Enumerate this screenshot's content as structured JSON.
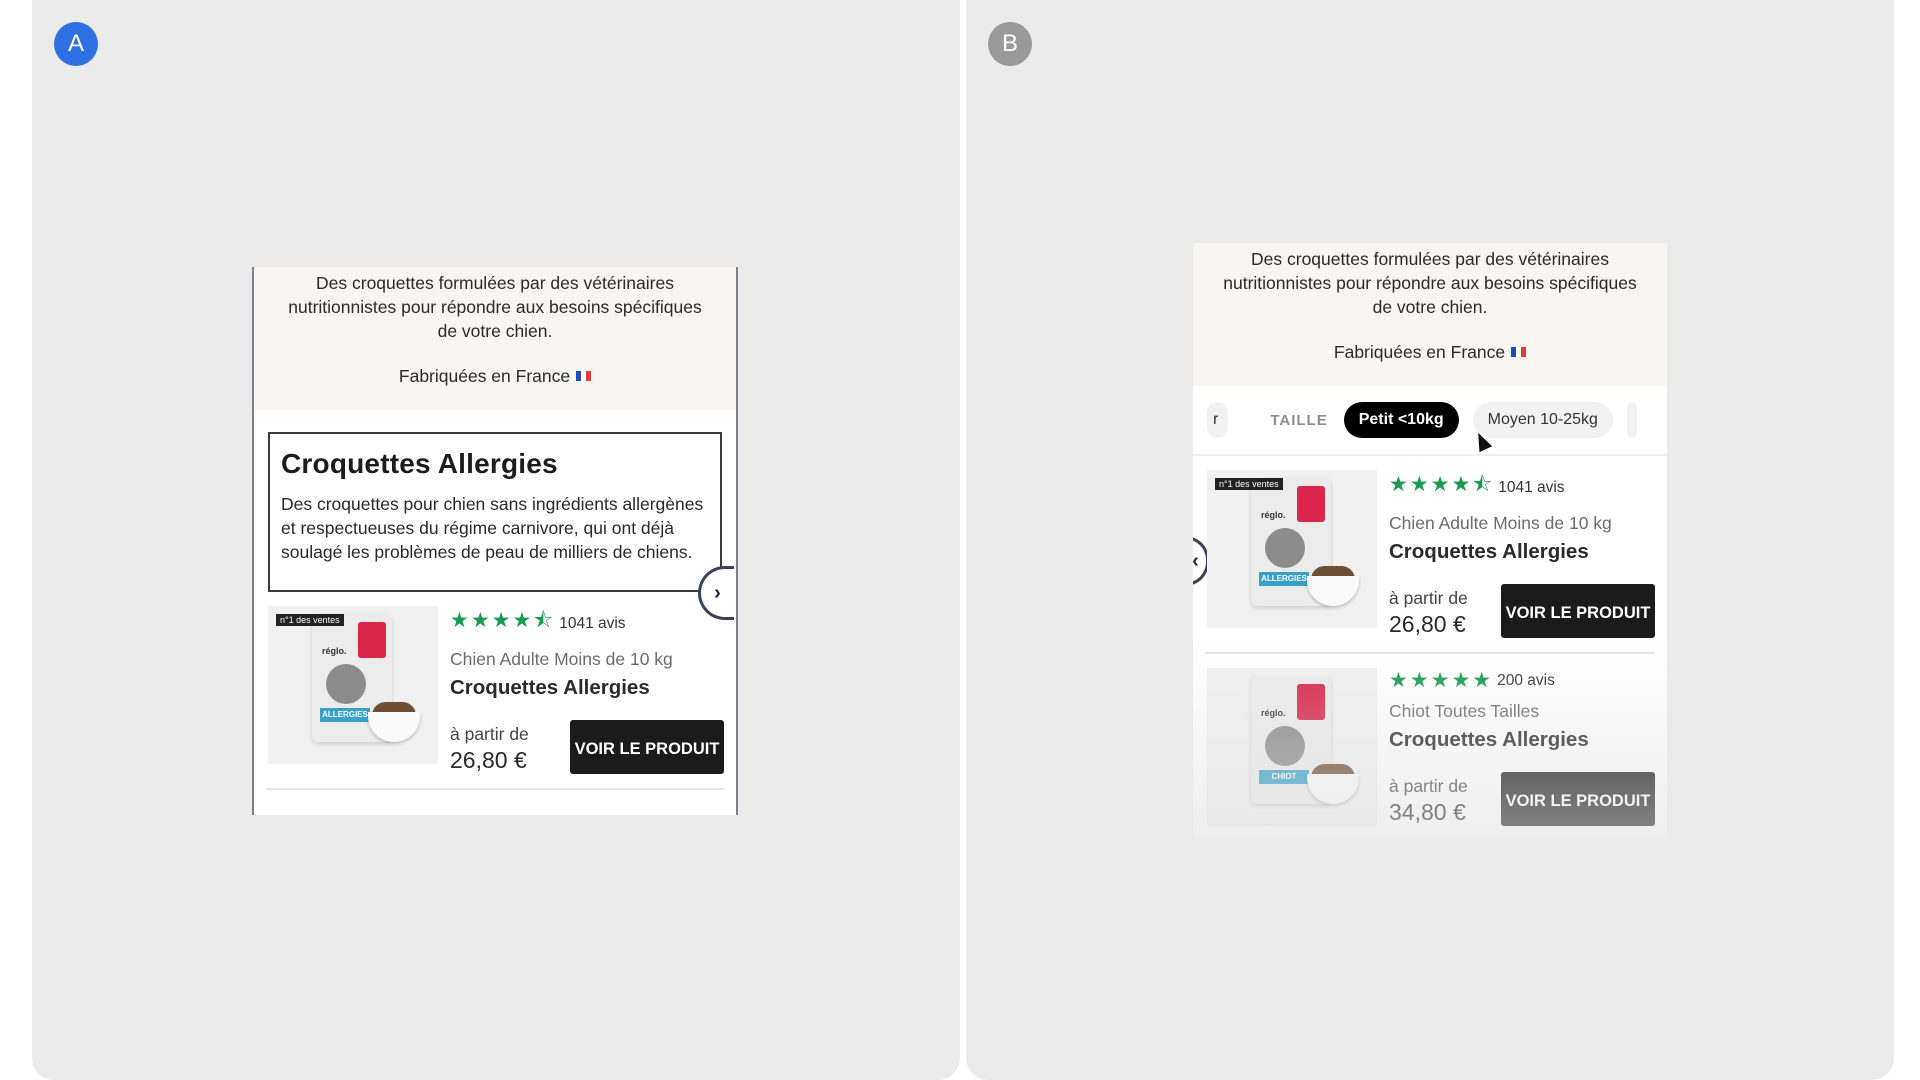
{
  "panels": {
    "a": {
      "badge": "A"
    },
    "b": {
      "badge": "B"
    }
  },
  "intro": {
    "text": "Des croquettes formulées par des vétérinaires nutritionnistes pour répondre aux besoins spécifiques de votre chien.",
    "made_in": "Fabriquées en France"
  },
  "category": {
    "title": "Croquettes Allergies",
    "description": "Des croquettes pour chien sans ingrédients allergènes et respectueuses du régime carnivore, qui ont déjà soulagé les problèmes de peau de milliers de chiens."
  },
  "filters": {
    "partial_chip": "r",
    "label": "TAILLE",
    "chips": [
      "Petit <10kg",
      "Moyen 10-25kg"
    ],
    "active_chip": "Petit <10kg"
  },
  "products": [
    {
      "rating": 4.5,
      "stars": "★★★★⯪",
      "reviews": "1041 avis",
      "subtitle": "Chien Adulte Moins de 10 kg",
      "name": "Croquettes Allergies",
      "from_label": "à partir de",
      "price": "26,80 €",
      "cta": "VOIR LE PRODUIT",
      "tag": "n°1 des ventes",
      "bag_brand": "réglo.",
      "bag_strip": "ALLERGIES"
    },
    {
      "rating": 5,
      "stars": "★★★★★",
      "reviews": "200 avis",
      "subtitle": "Chiot Toutes Tailles",
      "name": "Croquettes Allergies",
      "from_label": "à partir de",
      "price": "34,80 €",
      "cta": "VOIR LE PRODUIT",
      "bag_brand": "réglo.",
      "bag_strip": "CHIOT"
    }
  ],
  "colors": {
    "star_green": "#1a9a52",
    "cta_bg": "#1b1b1b",
    "badge_a": "#2f6fe4",
    "badge_b": "#9a9a9a"
  },
  "icons": {
    "next": "chevron-right-icon",
    "prev": "chevron-left-icon",
    "flag": "france-flag-icon"
  }
}
